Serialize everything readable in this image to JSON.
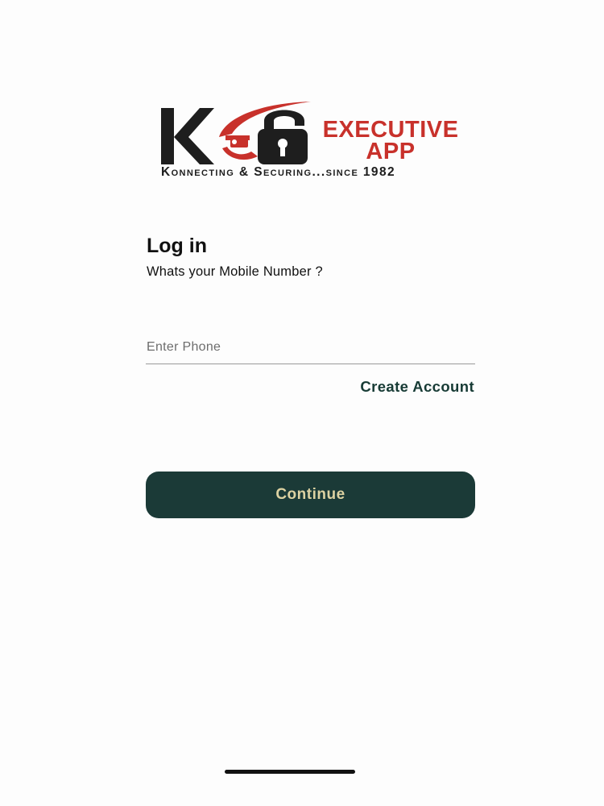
{
  "logo": {
    "letters": "KES",
    "title_line1": "EXECUTIVE",
    "title_line2": "APP",
    "tagline": "Konnecting & Securing...since 1982",
    "colors": {
      "red": "#c8312b",
      "dark": "#1e1e1e"
    },
    "icons": [
      "camera-icon",
      "padlock-icon"
    ]
  },
  "login": {
    "title": "Log in",
    "subtitle": "Whats your Mobile Number ?"
  },
  "phone_input": {
    "placeholder": "Enter Phone",
    "value": ""
  },
  "create_account_label": "Create Account",
  "continue_label": "Continue",
  "colors": {
    "primary": "#1b3a37",
    "button_text": "#ddd2a2",
    "link": "#173b35"
  }
}
